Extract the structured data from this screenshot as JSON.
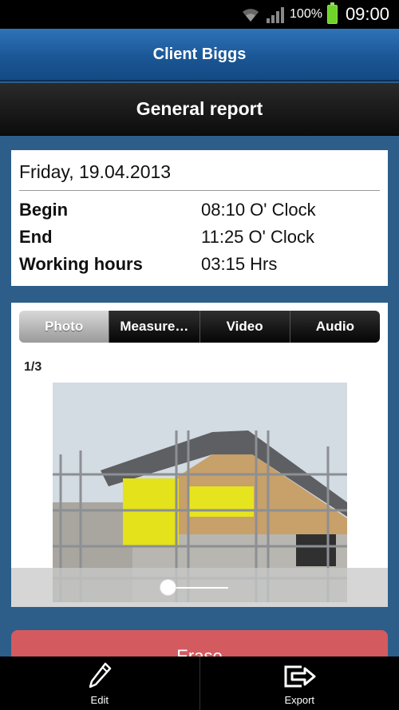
{
  "status_bar": {
    "battery_percent": "100%",
    "time": "09:00",
    "icons": [
      "wifi-icon",
      "signal-icon",
      "battery-icon"
    ]
  },
  "header": {
    "title": "Client Biggs",
    "subtitle": "General report"
  },
  "report": {
    "date": "Friday, 19.04.2013",
    "rows": [
      {
        "label": "Begin",
        "value": "08:10 O' Clock"
      },
      {
        "label": "End",
        "value": "11:25 O' Clock"
      },
      {
        "label": "Working hours",
        "value": "03:15 Hrs"
      }
    ]
  },
  "media": {
    "tabs": [
      {
        "label": "Photo",
        "active": true
      },
      {
        "label": "Measure…",
        "active": false
      },
      {
        "label": "Video",
        "active": false
      },
      {
        "label": "Audio",
        "active": false
      }
    ],
    "counter": "1/3",
    "slider_position": 0.0
  },
  "actions": {
    "erase_label": "Erase"
  },
  "bottom_bar": {
    "edit_label": "Edit",
    "export_label": "Export"
  },
  "colors": {
    "background": "#2d5e8a",
    "title_bar": "#1b5796",
    "erase_button": "#d35a5f"
  }
}
